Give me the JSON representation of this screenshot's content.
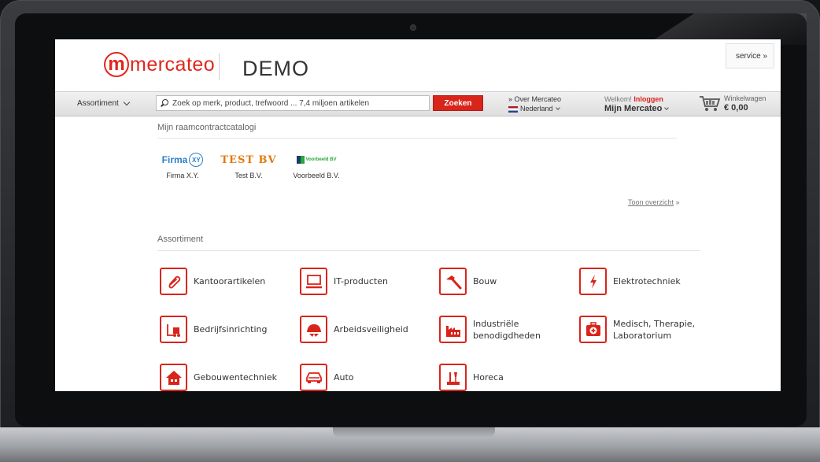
{
  "header": {
    "logo_text": "mercateo",
    "logo_letter": "m",
    "title": "DEMO",
    "service_label": "service »"
  },
  "navbar": {
    "assortment_label": "Assortiment",
    "search_placeholder": "Zoek op merk, product, trefwoord ... 7,4 miljoen artikelen",
    "search_button": "Zoeken",
    "over_link": "» Over Mercateo",
    "country": "Nederland",
    "welcome_text": "Welkom!",
    "login_link": "Inloggen",
    "mijn_mercateo": "Mijn Mercateo",
    "cart_label": "Winkelwagen",
    "cart_amount": "€ 0,00"
  },
  "catalogs": {
    "title": "Mijn raamcontractcatalogi",
    "items": [
      {
        "logo_word": "Firma",
        "logo_mark": "XY",
        "name": "Firma X.Y."
      },
      {
        "logo_word": "TEST BV",
        "name": "Test B.V."
      },
      {
        "logo_word": "Voorbeeld BV",
        "name": "Voorbeeld B.V."
      }
    ],
    "overview_link": "Toon overzicht",
    "overview_arrow": "»"
  },
  "assortment": {
    "title": "Assortiment",
    "categories": [
      {
        "label": "Kantoorartikelen",
        "icon": "paperclip-icon"
      },
      {
        "label": "IT-producten",
        "icon": "laptop-icon"
      },
      {
        "label": "Bouw",
        "icon": "hammer-icon"
      },
      {
        "label": "Elektrotechniek",
        "icon": "lightning-icon"
      },
      {
        "label": "Bedrijfsinrichting",
        "icon": "forklift-icon"
      },
      {
        "label": "Arbeidsveiligheid",
        "icon": "safety-helmet-icon"
      },
      {
        "label": "Industriële benodigdheden",
        "icon": "factory-icon"
      },
      {
        "label": "Medisch, Therapie, Laboratorium",
        "icon": "first-aid-icon"
      },
      {
        "label": "Gebouwentechniek",
        "icon": "house-icon"
      },
      {
        "label": "Auto",
        "icon": "car-icon"
      },
      {
        "label": "Horeca",
        "icon": "horeca-icon"
      }
    ]
  },
  "colors": {
    "brand_red": "#e1261c",
    "button_red": "#d9241a",
    "firma_blue": "#2a80c8",
    "test_orange": "#e07a10"
  }
}
